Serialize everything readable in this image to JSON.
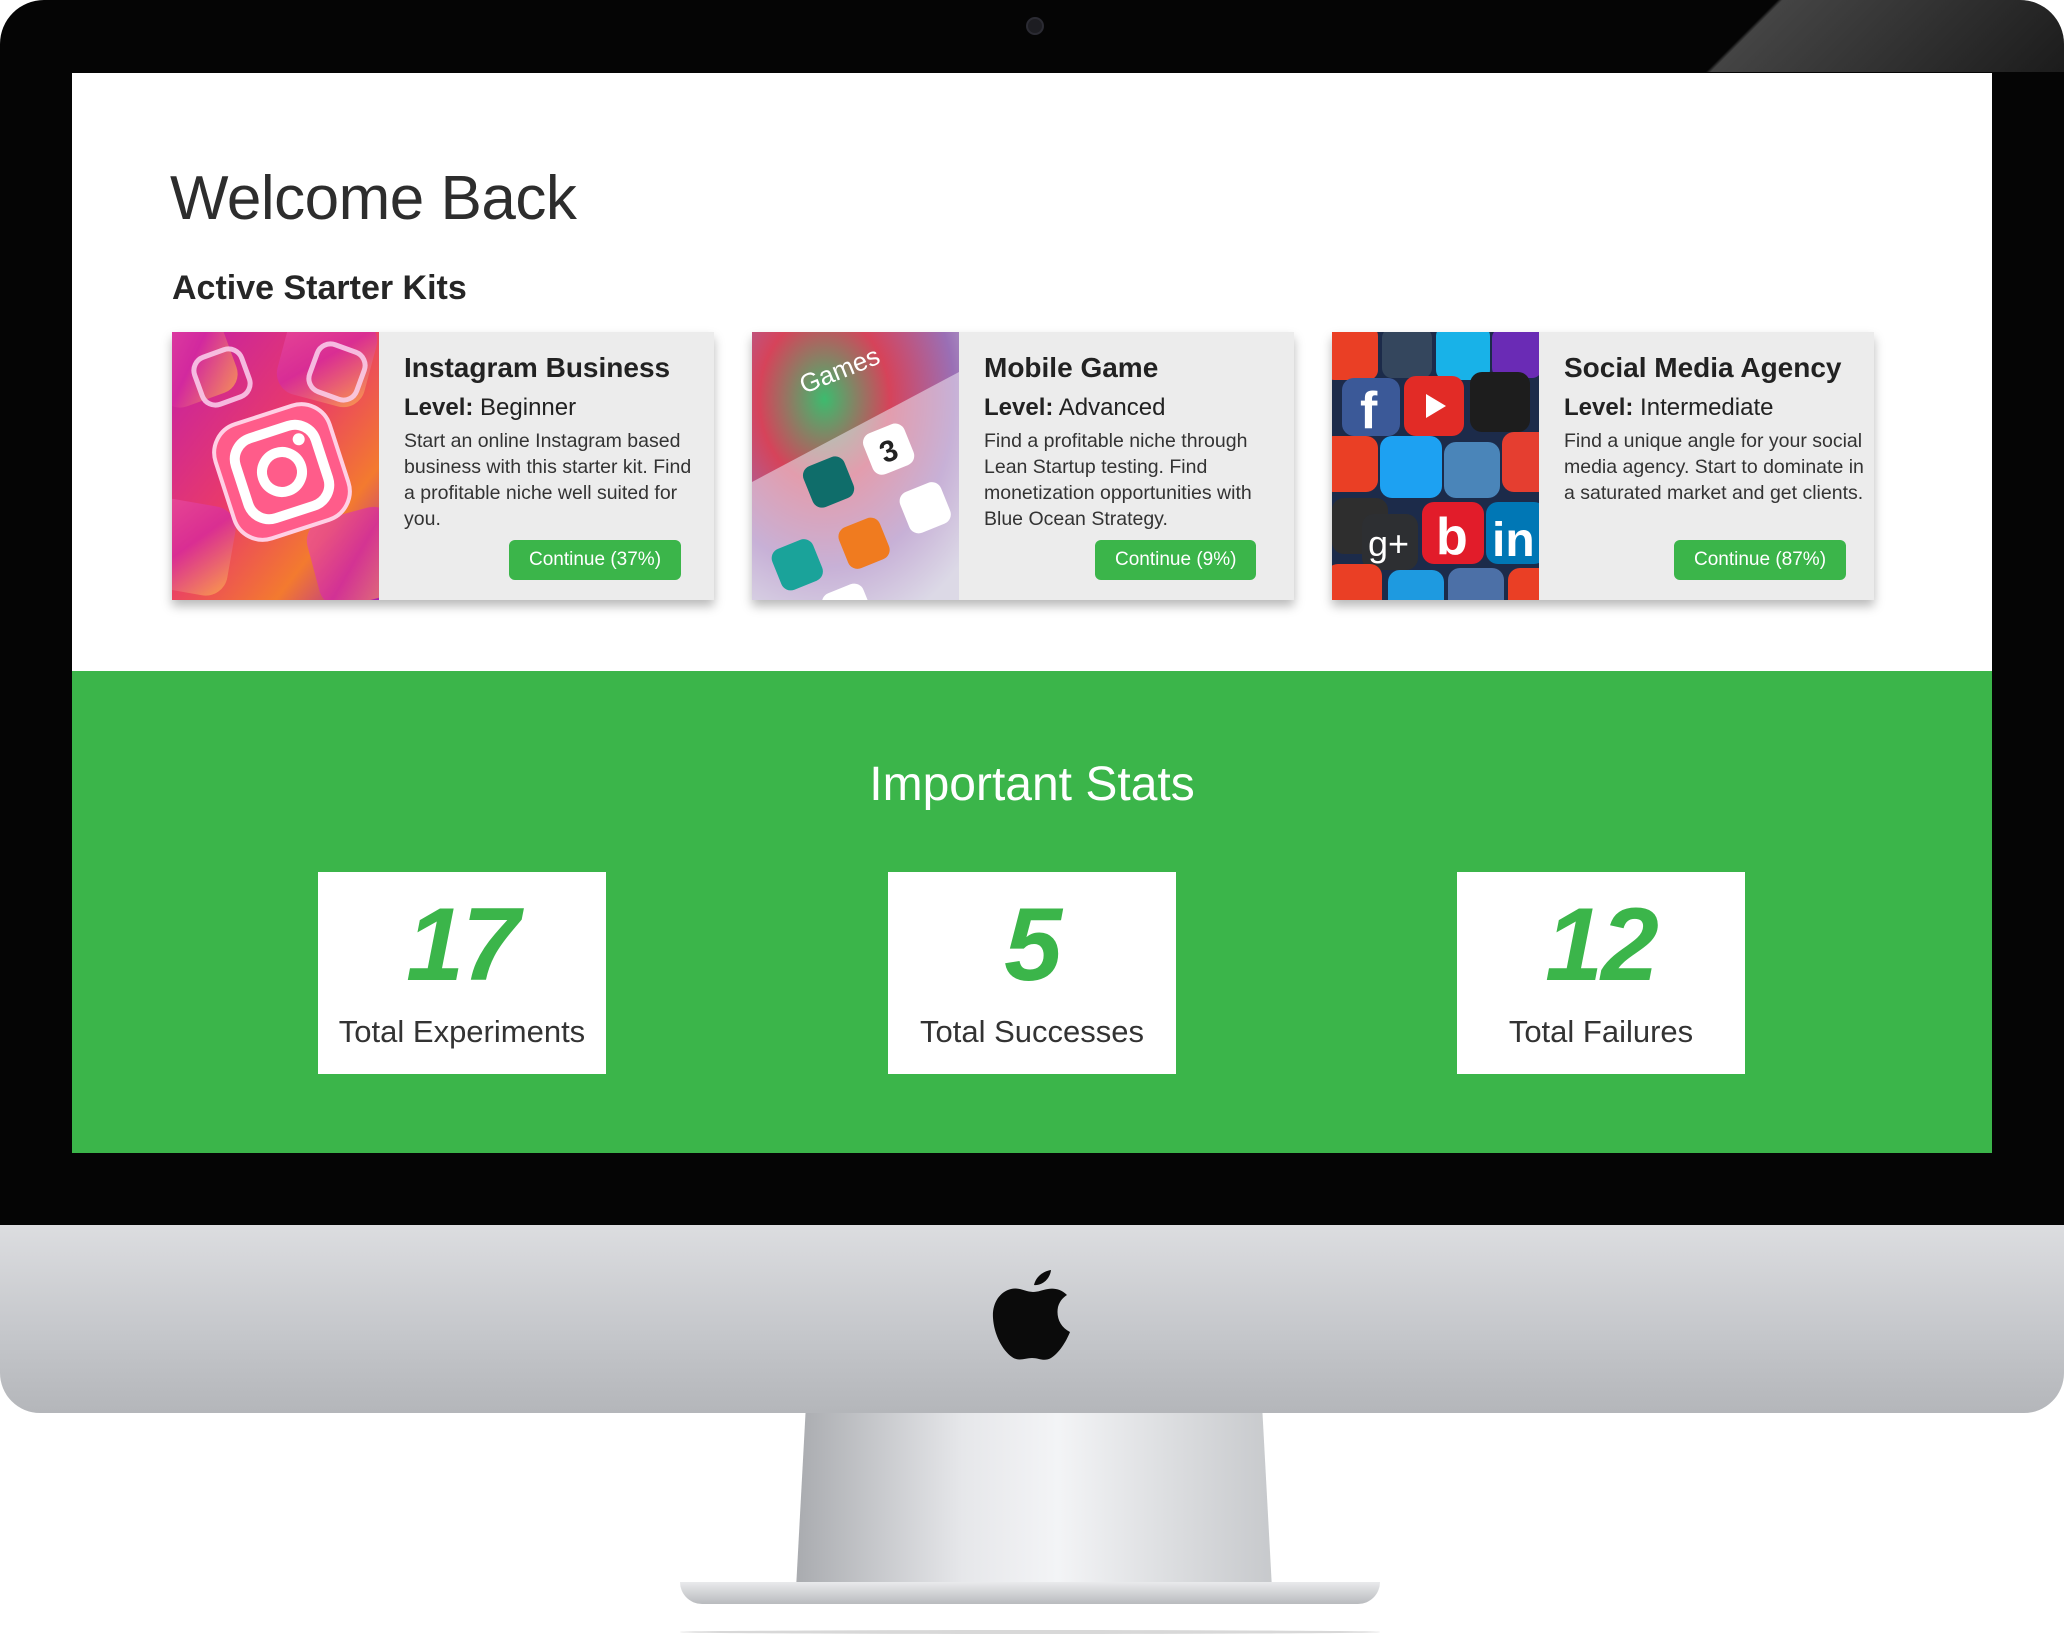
{
  "page": {
    "welcome_title": "Welcome Back",
    "kits_section_title": "Active Starter Kits"
  },
  "kits": [
    {
      "title": "Instagram Business",
      "level_label": "Level:",
      "level": "Beginner",
      "description": "Start an online Instagram based business with this starter kit. Find a profitable niche well suited for you.",
      "button_label": "Continue (37%)",
      "progress_percent": 37,
      "image": "instagram-icons-image"
    },
    {
      "title": "Mobile Game",
      "level_label": "Level:",
      "level": "Advanced",
      "description": "Find a profitable niche through Lean Startup testing. Find monetization opportunities with Blue Ocean Strategy.",
      "button_label": "Continue (9%)",
      "progress_percent": 9,
      "image": "games-folder-image",
      "image_text": "Games"
    },
    {
      "title": "Social Media Agency",
      "level_label": "Level:",
      "level": "Intermediate",
      "description": "Find a unique angle for your social media agency. Start to dominate in a saturated market and get clients.",
      "button_label": "Continue (87%)",
      "progress_percent": 87,
      "image": "social-media-icons-image"
    }
  ],
  "stats": {
    "title": "Important Stats",
    "items": [
      {
        "value": "17",
        "label": "Total Experiments"
      },
      {
        "value": "5",
        "label": "Total Successes"
      },
      {
        "value": "12",
        "label": "Total Failures"
      }
    ]
  },
  "colors": {
    "accent_green": "#3bb54a",
    "card_background": "#ececec",
    "bezel": "#050505",
    "chin": "#c4c6ca"
  },
  "device": {
    "logo": "apple-logo-icon"
  }
}
